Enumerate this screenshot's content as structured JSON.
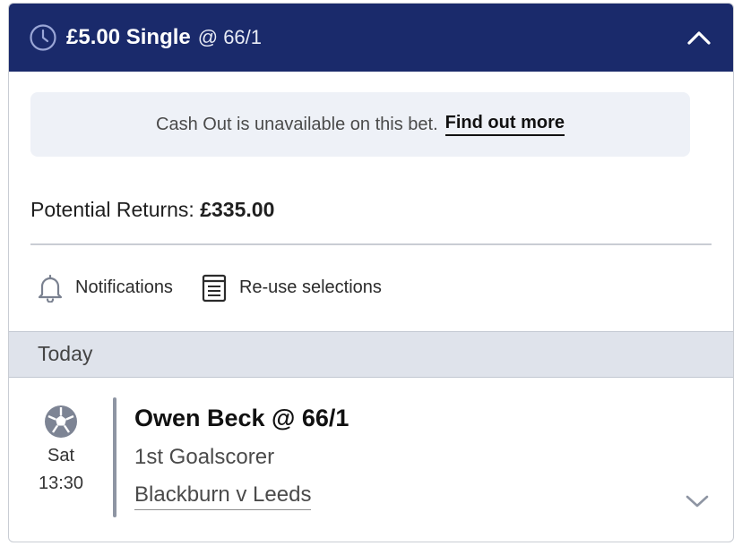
{
  "header": {
    "stake_label": "£5.00 Single",
    "odds_label": "@ 66/1",
    "icon": "clock-icon",
    "collapse_icon": "chevron-up-icon",
    "background": "#1a2a6b"
  },
  "cashout_notice": {
    "text": "Cash Out is unavailable on this bet.",
    "link": "Find out more"
  },
  "returns": {
    "label": "Potential Returns:",
    "amount": "£335.00"
  },
  "actions": [
    {
      "label": "Notifications",
      "icon": "bell-icon"
    },
    {
      "label": "Re-use selections",
      "icon": "document-list-icon"
    }
  ],
  "section": {
    "title": "Today"
  },
  "selection": {
    "sport_icon": "football-icon",
    "day": "Sat",
    "time": "13:30",
    "title": "Owen Beck @ 66/1",
    "market": "1st Goalscorer",
    "event": "Blackburn v Leeds",
    "expand_icon": "chevron-down-icon"
  }
}
